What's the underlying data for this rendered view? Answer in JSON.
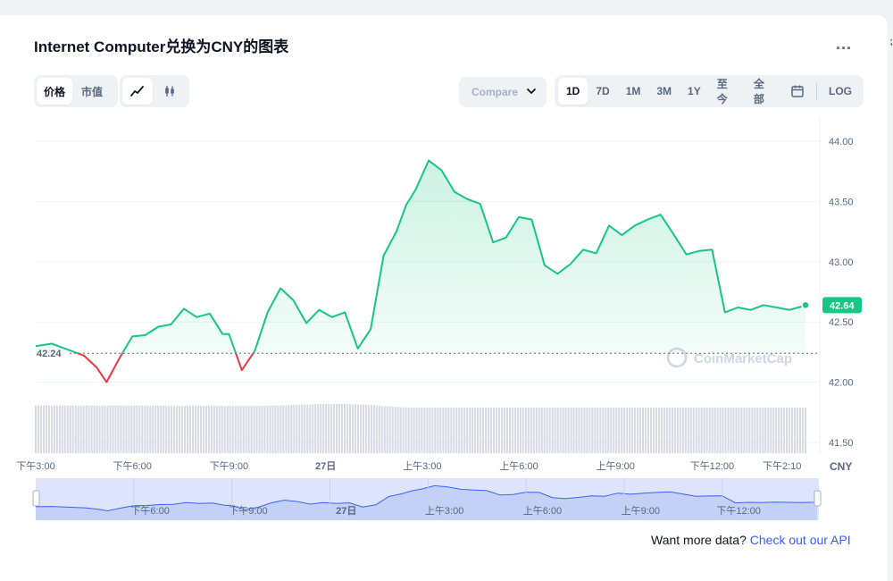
{
  "header": {
    "title": "Internet Computer兑换为CNY的图表",
    "more_label": "..."
  },
  "toolbar": {
    "metric_tabs": [
      {
        "label": "价格",
        "active": true
      },
      {
        "label": "市值",
        "active": false
      }
    ],
    "chart_types": [
      {
        "icon": "line-chart-icon",
        "active": true
      },
      {
        "icon": "candlestick-icon",
        "active": false
      }
    ],
    "compare_label": "Compare",
    "ranges": [
      {
        "label": "1D",
        "active": true
      },
      {
        "label": "7D",
        "active": false
      },
      {
        "label": "1M",
        "active": false
      },
      {
        "label": "3M",
        "active": false
      },
      {
        "label": "1Y",
        "active": false
      },
      {
        "label": "至今",
        "active": false
      },
      {
        "label": "全部",
        "active": false
      }
    ],
    "log_label": "LOG"
  },
  "footer": {
    "text": "Want more data?",
    "link": "Check out our API"
  },
  "watermark": "CoinMarketCap",
  "colors": {
    "up": "#16c784",
    "down": "#ea3943",
    "accent": "#3861fb",
    "muted": "#58667e"
  },
  "chart_data": {
    "type": "line",
    "currency": "CNY",
    "reference_value": 42.24,
    "reference_label": "42.24",
    "current_value": 42.64,
    "current_label": "42.64",
    "ylim": [
      41.5,
      44.0
    ],
    "yticks": [
      "44.00",
      "43.50",
      "43.00",
      "42.50",
      "42.00",
      "41.50"
    ],
    "xticks": [
      "下午3:00",
      "下午6:00",
      "下午9:00",
      "27日",
      "上午3:00",
      "上午6:00",
      "上午9:00",
      "下午12:00",
      "下午2:10"
    ],
    "navigator_ticks": [
      "下午6:00",
      "下午9:00",
      "27日",
      "上午3:00",
      "上午6:00",
      "上午9:00",
      "下午12:00"
    ],
    "x_hours": [
      0,
      0.5,
      1,
      1.5,
      1.9,
      2.2,
      2.6,
      3,
      3.4,
      3.8,
      4.2,
      4.6,
      5,
      5.4,
      5.8,
      6,
      6.4,
      6.8,
      7.2,
      7.6,
      8,
      8.4,
      8.8,
      9.2,
      9.6,
      10,
      10.4,
      10.8,
      11.2,
      11.5,
      11.8,
      12.2,
      12.6,
      13,
      13.4,
      13.8,
      14.2,
      14.6,
      15,
      15.4,
      15.8,
      16.2,
      16.6,
      17,
      17.4,
      17.8,
      18.2,
      18.6,
      19,
      19.4,
      19.8,
      20.2,
      20.6,
      21,
      21.4,
      21.8,
      22.2,
      22.6,
      23,
      23.4,
      23.8,
      23.9
    ],
    "prices": [
      42.3,
      42.32,
      42.27,
      42.22,
      42.12,
      42.0,
      42.2,
      42.38,
      42.39,
      42.46,
      42.48,
      42.61,
      42.54,
      42.57,
      42.4,
      42.4,
      42.1,
      42.26,
      42.58,
      42.78,
      42.68,
      42.49,
      42.6,
      42.54,
      42.58,
      42.28,
      42.44,
      43.05,
      43.25,
      43.47,
      43.6,
      43.84,
      43.76,
      43.58,
      43.52,
      43.48,
      43.16,
      43.2,
      43.37,
      43.35,
      42.97,
      42.9,
      42.98,
      43.1,
      43.07,
      43.3,
      43.22,
      43.3,
      43.35,
      43.39,
      43.23,
      43.06,
      43.09,
      43.1,
      42.58,
      42.62,
      42.6,
      42.64,
      42.62,
      42.6,
      42.63,
      42.64
    ],
    "volume_level": [
      0.97,
      0.97,
      0.97,
      0.97,
      0.97,
      0.97,
      0.97,
      0.97,
      0.97,
      0.97,
      0.96,
      0.96,
      0.96,
      0.96,
      0.96,
      0.96,
      0.96,
      0.96,
      0.97,
      0.97,
      0.98,
      0.99,
      1.0,
      1.0,
      1.0,
      0.99,
      0.98,
      0.96,
      0.94,
      0.93,
      0.93,
      0.93,
      0.93,
      0.93,
      0.93,
      0.93,
      0.93,
      0.93,
      0.93,
      0.93,
      0.93,
      0.93,
      0.93,
      0.93,
      0.93,
      0.93,
      0.93,
      0.93,
      0.93,
      0.93,
      0.93,
      0.93,
      0.93,
      0.93,
      0.93,
      0.93,
      0.93,
      0.93,
      0.93,
      0.93,
      0.93,
      0.93
    ]
  }
}
